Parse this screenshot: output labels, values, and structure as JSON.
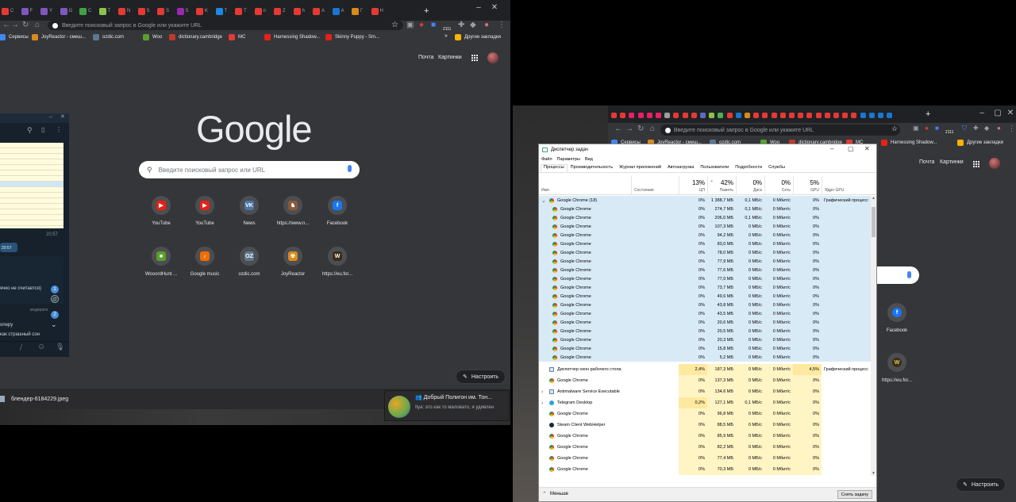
{
  "left_browser": {
    "tabs": [
      "C",
      "F",
      "Y",
      "G",
      "C",
      "T",
      "N",
      "S",
      "S",
      "S",
      "K",
      "T",
      "T",
      "n",
      "Z",
      "h",
      "A",
      "A",
      "Г",
      "Н"
    ],
    "new_tab_symbol": "+",
    "omnibox_placeholder": "Введите поисковый запрос в Google или укажите URL",
    "ext_badge": "2111",
    "bookmarks": [
      "Сервисы",
      "JoyReactor - смеш...",
      "ozdic.com",
      "Woo",
      "dictionary.cambridge",
      "MC",
      "Harnessing Shadow...",
      "Skinny Puppy - Sm..."
    ],
    "other_bookmarks": "Другие закладки",
    "more_bookmarks": "»",
    "top_links": {
      "mail": "Почта",
      "images": "Картинки"
    },
    "logo": "Google",
    "search_placeholder": "Введите поисковый запрос или URL",
    "shortcuts": [
      {
        "label": "YouTube",
        "color": "#e62117",
        "glyph": "▶"
      },
      {
        "label": "YouTube",
        "color": "#e62117",
        "glyph": "▶"
      },
      {
        "label": "News",
        "color": "#4a76a8",
        "glyph": "VK"
      },
      {
        "label": "https://www.n...",
        "color": "#8a5a3a",
        "glyph": "♞"
      },
      {
        "label": "Facebook",
        "color": "#1877f2",
        "glyph": "f"
      },
      {
        "label": "WooordHunt ...",
        "color": "#5aa02c",
        "glyph": "■"
      },
      {
        "label": "Google music",
        "color": "#ef6c00",
        "glyph": "♪"
      },
      {
        "label": "ozdic.com",
        "color": "#5b7892",
        "glyph": "OZ"
      },
      {
        "label": "JoyReactor",
        "color": "#d98a1c",
        "glyph": "☢"
      },
      {
        "label": "https://eu.for...",
        "color": "#3a2f1a",
        "glyph": "W"
      }
    ],
    "customize": "Настроить",
    "download_file": "блендер-6184229.jpeg"
  },
  "telegram": {
    "time1": "20:57",
    "time2": "20:57",
    "msg_partial": "ячко не считается)",
    "badge1": "1",
    "badge2": "2",
    "mention": "@",
    "moderator": "модерато",
    "line1": "оперу",
    "line2": "как страшный сон"
  },
  "notification": {
    "title": "Добрый Полигон им. Тон...",
    "body": "Ilya: это как то маловато, я удивлен"
  },
  "right_browser": {
    "omnibox_placeholder": "Введите поисковый запрос в Google или укажите URL",
    "ext_badge": "2111",
    "bookmarks": [
      "Сервисы",
      "JoyReactor - смеш...",
      "ozdic.com",
      "Woo",
      "dictionary.cambridge",
      "MC",
      "Harnessing Shadow..."
    ],
    "other_bookmarks": "Другие закладки",
    "top_links": {
      "mail": "Почта",
      "images": "Картинки"
    },
    "shortcuts": [
      "Facebook",
      "https://eu.for..."
    ],
    "customize": "Настроить"
  },
  "task_manager": {
    "title": "Диспетчер задач",
    "menu": [
      "Файл",
      "Параметры",
      "Вид"
    ],
    "tabs": [
      "Процессы",
      "Производительность",
      "Журнал приложений",
      "Автозагрузка",
      "Пользователи",
      "Подробности",
      "Службы"
    ],
    "columns": {
      "name": "Имя",
      "status": "Состояние",
      "cpu": {
        "pct": "13%",
        "label": "ЦП"
      },
      "mem": {
        "pct": "42%",
        "label": "Память"
      },
      "disk": {
        "pct": "0%",
        "label": "Диск"
      },
      "net": {
        "pct": "0%",
        "label": "Сеть"
      },
      "gpu": {
        "pct": "5%",
        "label": "GPU"
      },
      "gpu_engine": "Ядро GPU"
    },
    "group": {
      "name": "Google Chrome (18)",
      "cpu": "0%",
      "mem": "1 388,7 МБ",
      "disk": "0,1 МБ/с",
      "net": "0 Мбит/с",
      "gpu": "0%",
      "engine": "Графический процесс"
    },
    "children": [
      {
        "name": "Google Chrome",
        "cpu": "0%",
        "mem": "274,7 МБ",
        "disk": "0,1 МБ/с",
        "net": "0 Мбит/с",
        "gpu": "0%"
      },
      {
        "name": "Google Chrome",
        "cpu": "0%",
        "mem": "206,0 МБ",
        "disk": "0,1 МБ/с",
        "net": "0 Мбит/с",
        "gpu": "0%"
      },
      {
        "name": "Google Chrome",
        "cpu": "0%",
        "mem": "107,3 МБ",
        "disk": "0 МБ/с",
        "net": "0 Мбит/с",
        "gpu": "0%"
      },
      {
        "name": "Google Chrome",
        "cpu": "0%",
        "mem": "94,2 МБ",
        "disk": "0 МБ/с",
        "net": "0 Мбит/с",
        "gpu": "0%"
      },
      {
        "name": "Google Chrome",
        "cpu": "0%",
        "mem": "83,0 МБ",
        "disk": "0 МБ/с",
        "net": "0 Мбит/с",
        "gpu": "0%"
      },
      {
        "name": "Google Chrome",
        "cpu": "0%",
        "mem": "78,0 МБ",
        "disk": "0 МБ/с",
        "net": "0 Мбит/с",
        "gpu": "0%"
      },
      {
        "name": "Google Chrome",
        "cpu": "0%",
        "mem": "77,9 МБ",
        "disk": "0 МБ/с",
        "net": "0 Мбит/с",
        "gpu": "0%"
      },
      {
        "name": "Google Chrome",
        "cpu": "0%",
        "mem": "77,6 МБ",
        "disk": "0 МБ/с",
        "net": "0 Мбит/с",
        "gpu": "0%"
      },
      {
        "name": "Google Chrome",
        "cpu": "0%",
        "mem": "77,0 МБ",
        "disk": "0 МБ/с",
        "net": "0 Мбит/с",
        "gpu": "0%"
      },
      {
        "name": "Google Chrome",
        "cpu": "0%",
        "mem": "73,7 МБ",
        "disk": "0 МБ/с",
        "net": "0 Мбит/с",
        "gpu": "0%"
      },
      {
        "name": "Google Chrome",
        "cpu": "0%",
        "mem": "49,6 МБ",
        "disk": "0 МБ/с",
        "net": "0 Мбит/с",
        "gpu": "0%"
      },
      {
        "name": "Google Chrome",
        "cpu": "0%",
        "mem": "43,8 МБ",
        "disk": "0 МБ/с",
        "net": "0 Мбит/с",
        "gpu": "0%"
      },
      {
        "name": "Google Chrome",
        "cpu": "0%",
        "mem": "43,5 МБ",
        "disk": "0 МБ/с",
        "net": "0 Мбит/с",
        "gpu": "0%"
      },
      {
        "name": "Google Chrome",
        "cpu": "0%",
        "mem": "20,6 МБ",
        "disk": "0 МБ/с",
        "net": "0 Мбит/с",
        "gpu": "0%"
      },
      {
        "name": "Google Chrome",
        "cpu": "0%",
        "mem": "20,5 МБ",
        "disk": "0 МБ/с",
        "net": "0 Мбит/с",
        "gpu": "0%"
      },
      {
        "name": "Google Chrome",
        "cpu": "0%",
        "mem": "20,3 МБ",
        "disk": "0 МБ/с",
        "net": "0 Мбит/с",
        "gpu": "0%"
      },
      {
        "name": "Google Chrome",
        "cpu": "0%",
        "mem": "15,8 МБ",
        "disk": "0 МБ/с",
        "net": "0 Мбит/с",
        "gpu": "0%"
      },
      {
        "name": "Google Chrome",
        "cpu": "0%",
        "mem": "5,2 МБ",
        "disk": "0 МБ/с",
        "net": "0 Мбит/с",
        "gpu": "0%"
      }
    ],
    "others": [
      {
        "name": "Диспетчер окон рабочего стола",
        "icon": "dwm",
        "expand": false,
        "cpu": "2,4%",
        "mem": "187,3 МБ",
        "disk": "0 МБ/с",
        "net": "0 Мбит/с",
        "gpu": "4,5%",
        "engine": "Графический процесс"
      },
      {
        "name": "Google Chrome",
        "icon": "chrome",
        "expand": false,
        "cpu": "0%",
        "mem": "137,3 МБ",
        "disk": "0 МБ/с",
        "net": "0 Мбит/с",
        "gpu": "0%",
        "engine": ""
      },
      {
        "name": "Antimalware Service Executable",
        "icon": "box",
        "expand": true,
        "cpu": "0%",
        "mem": "134,6 МБ",
        "disk": "0 МБ/с",
        "net": "0 Мбит/с",
        "gpu": "0%",
        "engine": ""
      },
      {
        "name": "Telegram Desktop",
        "icon": "telegram",
        "expand": true,
        "cpu": "0,2%",
        "mem": "127,1 МБ",
        "disk": "0,1 МБ/с",
        "net": "0 Мбит/с",
        "gpu": "0%",
        "engine": ""
      },
      {
        "name": "Google Chrome",
        "icon": "chrome",
        "expand": false,
        "cpu": "0%",
        "mem": "96,8 МБ",
        "disk": "0 МБ/с",
        "net": "0 Мбит/с",
        "gpu": "0%",
        "engine": ""
      },
      {
        "name": "Steam Client WebHelper",
        "icon": "steam",
        "expand": false,
        "cpu": "0%",
        "mem": "88,5 МБ",
        "disk": "0 МБ/с",
        "net": "0 Мбит/с",
        "gpu": "0%",
        "engine": ""
      },
      {
        "name": "Google Chrome",
        "icon": "chrome",
        "expand": false,
        "cpu": "0%",
        "mem": "85,9 МБ",
        "disk": "0 МБ/с",
        "net": "0 Мбит/с",
        "gpu": "0%",
        "engine": ""
      },
      {
        "name": "Google Chrome",
        "icon": "chrome",
        "expand": false,
        "cpu": "0%",
        "mem": "82,2 МБ",
        "disk": "0 МБ/с",
        "net": "0 Мбит/с",
        "gpu": "0%",
        "engine": ""
      },
      {
        "name": "Google Chrome",
        "icon": "chrome",
        "expand": false,
        "cpu": "0%",
        "mem": "77,4 МБ",
        "disk": "0 МБ/с",
        "net": "0 Мбит/с",
        "gpu": "0%",
        "engine": ""
      },
      {
        "name": "Google Chrome",
        "icon": "chrome",
        "expand": false,
        "cpu": "0%",
        "mem": "70,3 МБ",
        "disk": "0 МБ/с",
        "net": "0 Мбит/с",
        "gpu": "0%",
        "engine": ""
      }
    ],
    "fewer_details": "Меньше",
    "end_task": "Снять задачу"
  },
  "colors": {
    "chrome_dark": "#35363a",
    "tabstrip": "#202124",
    "highlight_row": "#d9eaf7",
    "heat_cell": "#fff4c4",
    "heat_cell_strong": "#ffe9a0"
  }
}
